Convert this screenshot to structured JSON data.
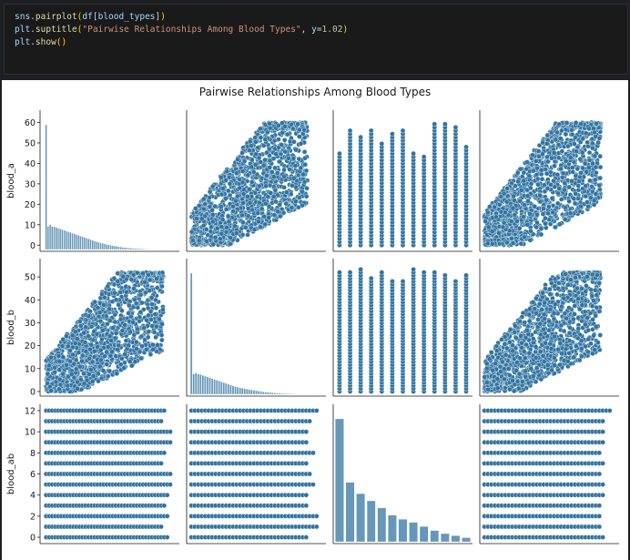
{
  "code": {
    "line1": {
      "var": "sns",
      "dot": ".",
      "fn": "pairplot",
      "open": "(",
      "arg_var": "df",
      "arg_open": "[",
      "arg_name": "blood_types",
      "arg_close": "]",
      "close": ")"
    },
    "line2": {
      "var": "plt",
      "dot": ".",
      "fn": "suptitle",
      "open": "(",
      "str": "\"Pairwise Relationships Among Blood Types\"",
      "sep": ", ",
      "kw": "y",
      "eq": "=",
      "num": "1.02",
      "close": ")"
    },
    "line3": {
      "var": "plt",
      "dot": ".",
      "fn": "show",
      "parens": "()"
    }
  },
  "chart_data": {
    "type": "scatter",
    "title": "Pairwise Relationships Among Blood Types",
    "variables": [
      "blood_a",
      "blood_b",
      "blood_ab"
    ],
    "color": "#3274a1",
    "ranges": {
      "blood_a": [
        -3,
        66
      ],
      "blood_b": [
        -2,
        58
      ],
      "blood_ab": [
        -0.6,
        12.6
      ]
    },
    "ticks": {
      "blood_a": [
        0,
        10,
        20,
        30,
        40,
        50,
        60
      ],
      "blood_b": [
        0,
        10,
        20,
        30,
        40,
        50
      ],
      "blood_ab": [
        0,
        2,
        4,
        6,
        8,
        10,
        12
      ]
    },
    "histograms": {
      "blood_a": {
        "bins": [
          0,
          1,
          2,
          3,
          4,
          5,
          6,
          7,
          8,
          9,
          10,
          11,
          12,
          13,
          14,
          15,
          16,
          17,
          18,
          19,
          20,
          21,
          22,
          23,
          24,
          25,
          26,
          27,
          28,
          29,
          30,
          31,
          32,
          33,
          34,
          35,
          36,
          37,
          38,
          39,
          40,
          41,
          42,
          43,
          44,
          45,
          46,
          47,
          48,
          49,
          50,
          51,
          52,
          53,
          54,
          55,
          56,
          57,
          58,
          59,
          60,
          61,
          62,
          63
        ],
        "heights": [
          35,
          6.5,
          7,
          6.5,
          6.4,
          6.2,
          6,
          5.8,
          5.6,
          5.4,
          5.2,
          5,
          4.8,
          4.6,
          4.4,
          4.2,
          4,
          3.8,
          3.6,
          3.4,
          3.2,
          3,
          2.8,
          2.6,
          2.4,
          2.2,
          2,
          1.9,
          1.7,
          1.6,
          1.4,
          1.3,
          1.2,
          1.1,
          1,
          0.9,
          0.8,
          0.7,
          0.6,
          0.55,
          0.5,
          0.45,
          0.4,
          0.35,
          0.3,
          0.28,
          0.25,
          0.22,
          0.2,
          0.18,
          0.15,
          0.13,
          0.12,
          0.1,
          0.09,
          0.08,
          0.07,
          0.06,
          0.05,
          0.04,
          0.04,
          0.03,
          0.03,
          0.02
        ]
      },
      "blood_b": {
        "bins": [
          0,
          1,
          2,
          3,
          4,
          5,
          6,
          7,
          8,
          9,
          10,
          11,
          12,
          13,
          14,
          15,
          16,
          17,
          18,
          19,
          20,
          21,
          22,
          23,
          24,
          25,
          26,
          27,
          28,
          29,
          30,
          31,
          32,
          33,
          34,
          35,
          36,
          37,
          38,
          39,
          40,
          41,
          42,
          43,
          44,
          45,
          46,
          47,
          48,
          49,
          50,
          51,
          52,
          53,
          54,
          55
        ],
        "heights": [
          30,
          5,
          5.3,
          5,
          4.9,
          4.7,
          4.5,
          4.3,
          4.1,
          3.9,
          3.7,
          3.5,
          3.3,
          3.1,
          2.9,
          2.7,
          2.5,
          2.3,
          2.1,
          1.9,
          1.8,
          1.6,
          1.5,
          1.4,
          1.3,
          1.2,
          1.1,
          1,
          0.9,
          0.8,
          0.7,
          0.6,
          0.55,
          0.5,
          0.45,
          0.4,
          0.35,
          0.3,
          0.27,
          0.24,
          0.2,
          0.18,
          0.15,
          0.13,
          0.11,
          0.1,
          0.08,
          0.07,
          0.06,
          0.05,
          0.04,
          0.03,
          0.03,
          0.02,
          0.02,
          0.02
        ]
      },
      "blood_ab": {
        "bins": [
          0,
          1,
          2,
          3,
          4,
          5,
          6,
          7,
          8,
          9,
          10,
          11,
          12
        ],
        "heights": [
          12,
          5.8,
          4.7,
          4,
          3.3,
          2.6,
          2.2,
          1.9,
          1.5,
          1.1,
          0.8,
          0.6,
          0.4
        ]
      }
    },
    "scatter_extents": {
      "blood_a_vs_blood_b": {
        "x_max_at_y0": 23,
        "y_max_at_x0": 30,
        "x_max": 57,
        "y_max": 64
      },
      "blood_a_vs_blood_ab": {
        "blood_ab_values": [
          0,
          1,
          2,
          3,
          4,
          5,
          6,
          7,
          8,
          9,
          10,
          11,
          12
        ],
        "blood_a_min": 0,
        "blood_a_max": 63
      },
      "blood_b_vs_blood_ab": {
        "blood_ab_values": [
          0,
          1,
          2,
          3,
          4,
          5,
          6,
          7,
          8,
          9,
          10,
          11,
          12
        ],
        "blood_b_min": 0,
        "blood_b_max": 55
      }
    }
  }
}
